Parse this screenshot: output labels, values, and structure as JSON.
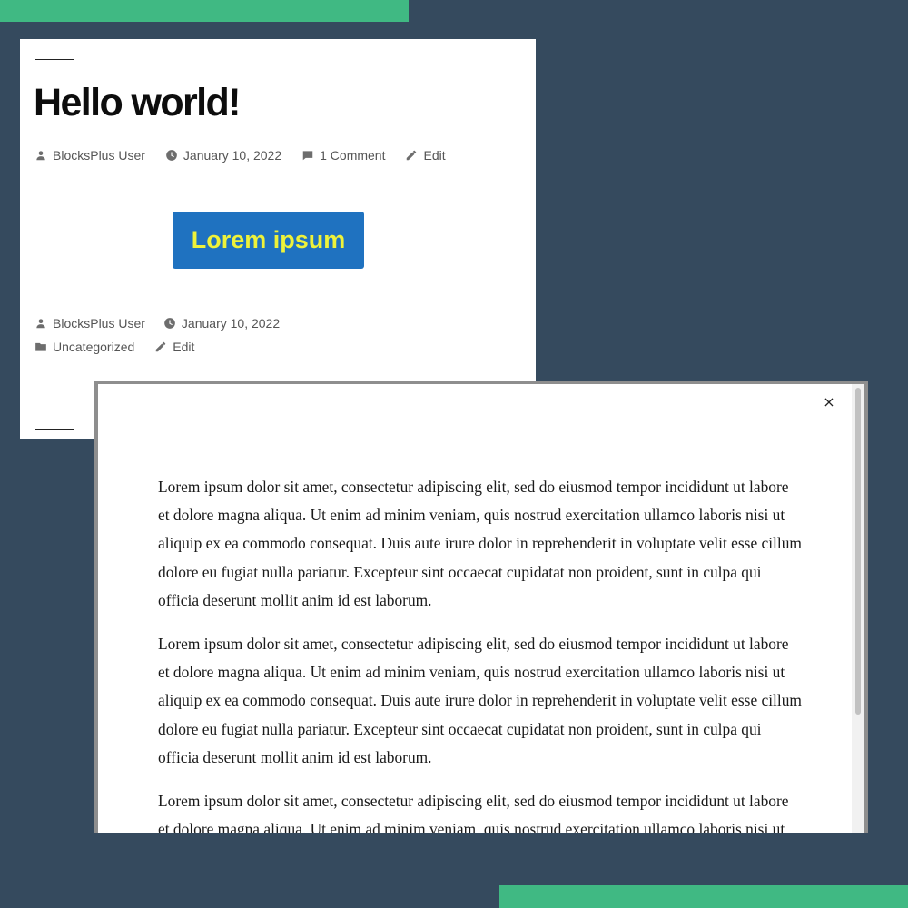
{
  "post": {
    "title": "Hello world!",
    "meta_top": {
      "author": "BlocksPlus User",
      "date": "January 10, 2022",
      "comments": "1 Comment",
      "edit": "Edit"
    },
    "button_label": "Lorem ipsum",
    "meta_bottom": {
      "author": "BlocksPlus User",
      "date": "January 10, 2022",
      "category": "Uncategorized",
      "edit": "Edit"
    }
  },
  "modal": {
    "close_label": "×",
    "paragraphs": [
      "Lorem ipsum dolor sit amet, consectetur adipiscing elit, sed do eiusmod tempor incididunt ut labore et dolore magna aliqua. Ut enim ad minim veniam, quis nostrud exercitation ullamco laboris nisi ut aliquip ex ea commodo consequat. Duis aute irure dolor in reprehenderit in voluptate velit esse cillum dolore eu fugiat nulla pariatur. Excepteur sint occaecat cupidatat non proident, sunt in culpa qui officia deserunt mollit anim id est laborum.",
      "Lorem ipsum dolor sit amet, consectetur adipiscing elit, sed do eiusmod tempor incididunt ut labore et dolore magna aliqua. Ut enim ad minim veniam, quis nostrud exercitation ullamco laboris nisi ut aliquip ex ea commodo consequat. Duis aute irure dolor in reprehenderit in voluptate velit esse cillum dolore eu fugiat nulla pariatur. Excepteur sint occaecat cupidatat non proident, sunt in culpa qui officia deserunt mollit anim id est laborum.",
      "Lorem ipsum dolor sit amet, consectetur adipiscing elit, sed do eiusmod tempor incididunt ut labore et dolore magna aliqua. Ut enim ad minim veniam, quis nostrud exercitation ullamco laboris nisi ut aliquip ex ea commodo consequat."
    ]
  },
  "colors": {
    "background": "#354a5e",
    "accent": "#40b983",
    "button_bg": "#1f72c0",
    "button_text": "#eef23a"
  },
  "icons": [
    "user-icon",
    "clock-icon",
    "comment-icon",
    "pencil-icon",
    "folder-icon",
    "close-icon"
  ]
}
